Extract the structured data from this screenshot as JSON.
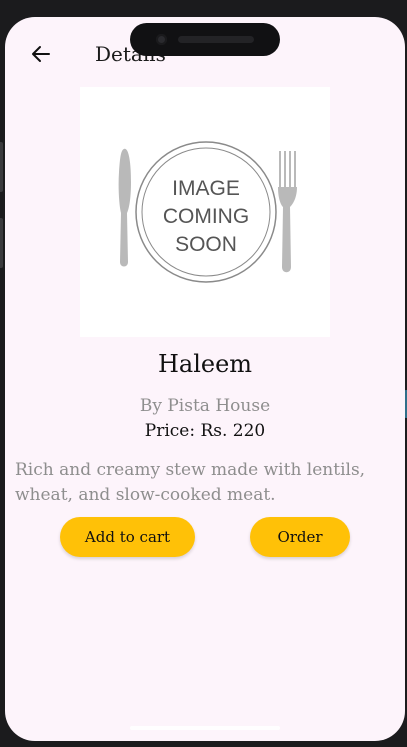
{
  "header": {
    "title": "Details"
  },
  "image": {
    "placeholder_line1": "IMAGE",
    "placeholder_line2": "COMING",
    "placeholder_line3": "SOON"
  },
  "item": {
    "name": "Haleem",
    "restaurant": "By Pista House",
    "price": "Price: Rs. 220",
    "description": "Rich and creamy stew made with lentils, wheat, and slow-cooked meat."
  },
  "actions": {
    "add_to_cart_label": "Add to cart",
    "order_label": "Order"
  },
  "colors": {
    "accent": "#ffc107",
    "background": "#fdf4fb",
    "muted_text": "#8e8e8e"
  }
}
